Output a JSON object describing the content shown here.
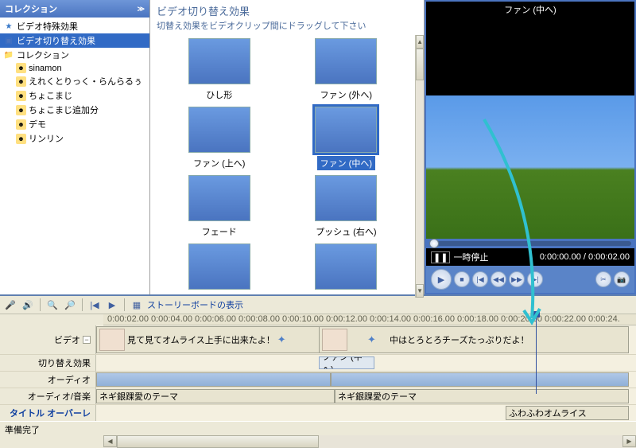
{
  "left_panel": {
    "header": "コレクション",
    "items": [
      {
        "icon": "star",
        "label": "ビデオ特殊効果"
      },
      {
        "icon": "trans",
        "label": "ビデオ切り替え効果",
        "selected": true
      },
      {
        "icon": "folder",
        "label": "コレクション"
      },
      {
        "icon": "face",
        "label": "sinamon",
        "child": true
      },
      {
        "icon": "face",
        "label": "えれくとりっく・らんらるぅ",
        "child": true
      },
      {
        "icon": "face",
        "label": "ちょこまじ",
        "child": true
      },
      {
        "icon": "face",
        "label": "ちょこまじ追加分",
        "child": true
      },
      {
        "icon": "face",
        "label": "デモ",
        "child": true
      },
      {
        "icon": "face",
        "label": "リンリン",
        "child": true
      }
    ]
  },
  "center": {
    "title": "ビデオ切り替え効果",
    "subtitle": "切替え効果をビデオクリップ間にドラッグして下さい",
    "thumbs": [
      {
        "label": "ひし形"
      },
      {
        "label": "ファン (外へ)"
      },
      {
        "label": "ファン (上へ)"
      },
      {
        "label": "ファン (中へ)",
        "selected": true
      },
      {
        "label": "フェード"
      },
      {
        "label": "プッシュ (右へ)"
      },
      {
        "label": ""
      },
      {
        "label": ""
      }
    ]
  },
  "preview": {
    "title": "ファン (中へ)",
    "pause_label": "一時停止",
    "time_current": "0:00:00.00",
    "time_total": "0:00:02.00",
    "time_sep": " / "
  },
  "timeline_toolbar": {
    "storyboard_label": "ストーリーボードの表示"
  },
  "ruler_ticks": [
    "0:00:02.00",
    "0:00:04.00",
    "0:00:06.00",
    "0:00:08.00",
    "0:00:10.00",
    "0:00:12.00",
    "0:00:14.00",
    "0:00:16.00",
    "0:00:18.00",
    "0:00:20.00",
    "0:00:22.00",
    "0:00:24."
  ],
  "tracks": {
    "video": "ビデオ",
    "transition": "切り替え効果",
    "audio": "オーディオ",
    "audio_music": "オーディオ/音楽",
    "title_overlay": "タイトル オーバーレイ"
  },
  "clips": {
    "video1_text": "見て見てオムライス上手に出来たよ！",
    "video2_text_a": "中はとろとろチーズたっぷりだよ！",
    "trans1": "ファン (中へ)",
    "audio1": "ネギ銀踝愛のテーマ",
    "audio2": "ネギ銀踝愛のテーマ",
    "title1": "ふわふわオムライス"
  },
  "status": "準備完了"
}
